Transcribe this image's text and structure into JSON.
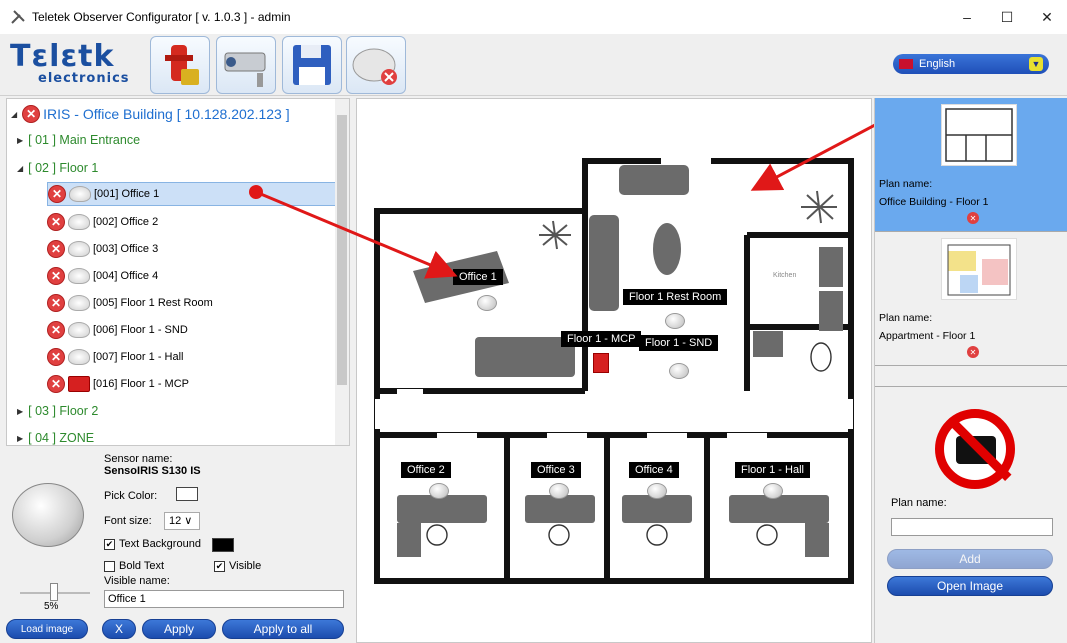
{
  "window": {
    "title": "Teletek Observer Configurator [ v. 1.0.3 ] - admin",
    "minimize": "–",
    "maximize": "☐",
    "close": "✕"
  },
  "logo": {
    "line1": "Tɛlɛtk",
    "line2": "electronics"
  },
  "language": {
    "selected": "English"
  },
  "tree": {
    "root": "IRIS - Office Building [ 10.128.202.123 ]",
    "nodes": [
      {
        "label": "[ 01 ] Main Entrance"
      },
      {
        "label": "[ 02 ] Floor 1"
      },
      {
        "label": "[ 03 ] Floor 2"
      },
      {
        "label": "[ 04 ] ZONE"
      }
    ],
    "devices": [
      {
        "label": "[001] Office 1",
        "type": "detector"
      },
      {
        "label": "[002] Office 2",
        "type": "detector"
      },
      {
        "label": "[003] Office 3",
        "type": "detector"
      },
      {
        "label": "[004] Office 4",
        "type": "detector"
      },
      {
        "label": "[005] Floor 1 Rest Room",
        "type": "detector"
      },
      {
        "label": "[006] Floor 1 - SND",
        "type": "sounder"
      },
      {
        "label": "[007] Floor 1 - Hall",
        "type": "detector"
      },
      {
        "label": "[016] Floor 1 - MCP",
        "type": "mcp"
      }
    ]
  },
  "properties": {
    "sensor_name_label": "Sensor name:",
    "sensor_name": "SensoIRIS S130 IS",
    "pick_color_label": "Pick Color:",
    "font_size_label": "Font size:",
    "font_size": "12",
    "text_background_label": "Text Background",
    "text_background_checked": true,
    "bold_text_label": "Bold Text",
    "bold_text_checked": false,
    "visible_label": "Visible",
    "visible_checked": true,
    "visible_name_label": "Visible name:",
    "visible_name": "Office 1",
    "zoom": "5%",
    "load_image": "Load image",
    "x_button": "X",
    "apply": "Apply",
    "apply_all": "Apply to all"
  },
  "floorplan": {
    "labels": [
      {
        "text": "Office 1"
      },
      {
        "text": "Floor 1 Rest Room"
      },
      {
        "text": "Floor 1 - MCP"
      },
      {
        "text": "Floor 1 - SND"
      },
      {
        "text": "Office 2"
      },
      {
        "text": "Office 3"
      },
      {
        "text": "Office 4"
      },
      {
        "text": "Floor 1 - Hall"
      }
    ],
    "kitchen": "Kitchen"
  },
  "plans": {
    "items": [
      {
        "name_label": "Plan name:",
        "name": "Office Building - Floor 1",
        "selected": true
      },
      {
        "name_label": "Plan name:",
        "name": "Appartment - Floor 1",
        "selected": false
      }
    ],
    "add": {
      "name_label": "Plan name:",
      "name_value": "",
      "add_button": "Add",
      "open_button": "Open Image"
    }
  },
  "colors": {
    "accent": "#1c4cae",
    "selection": "#6aa9ee",
    "error": "#e04040"
  }
}
